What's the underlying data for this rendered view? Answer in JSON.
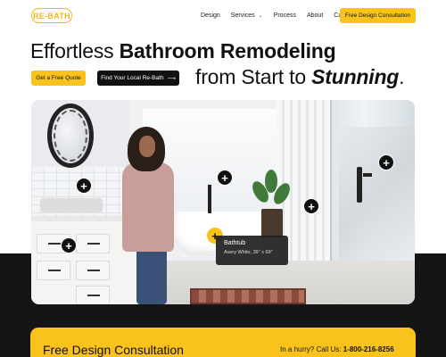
{
  "nav": {
    "logo": "RE-BATH",
    "links": [
      "Design",
      "Services",
      "Process",
      "About",
      "Careers"
    ],
    "cta": "Free Design Consultation"
  },
  "hero": {
    "headline_regular": "Effortless ",
    "headline_bold": "Bathroom Remodeling",
    "subhead_regular": "from Start to ",
    "subhead_italic": "Stunning",
    "subhead_end": ".",
    "btn_quote": "Get a Free Quote",
    "btn_find": "Find Your Local Re-Bath",
    "btn_find_arrow": "⟶"
  },
  "photo": {
    "hotspot_symbol": "+",
    "tooltip_title": "Bathtub",
    "tooltip_subtitle": "Avery White, 39\" x 69\""
  },
  "consultation": {
    "title": "Free Design Consultation",
    "call_prefix": "In a hurry? Call Us: ",
    "phone": "1-800-216-8256"
  },
  "colors": {
    "accent": "#f9c31c",
    "dark": "#151515"
  }
}
